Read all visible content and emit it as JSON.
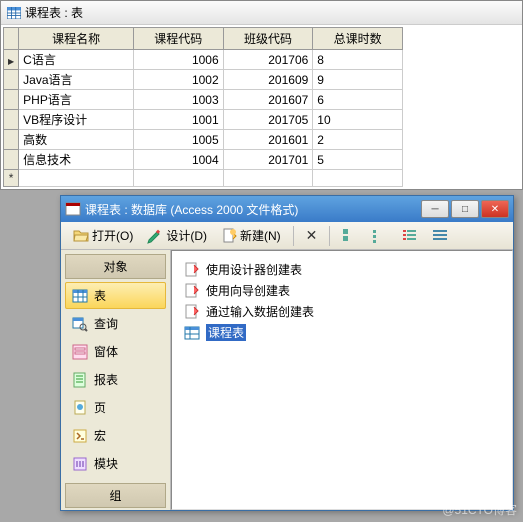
{
  "table_window": {
    "title": "课程表 : 表",
    "columns": [
      "课程名称",
      "课程代码",
      "班级代码",
      "总课时数"
    ],
    "rows": [
      {
        "c1": "C语言",
        "c2": "1006",
        "c3": "201706",
        "c4": "8"
      },
      {
        "c1": "Java语言",
        "c2": "1002",
        "c3": "201609",
        "c4": "9"
      },
      {
        "c1": "PHP语言",
        "c2": "1003",
        "c3": "201607",
        "c4": "6"
      },
      {
        "c1": "VB程序设计",
        "c2": "1001",
        "c3": "201705",
        "c4": "10"
      },
      {
        "c1": "高数",
        "c2": "1005",
        "c3": "201601",
        "c4": "2"
      },
      {
        "c1": "信息技术",
        "c2": "1004",
        "c3": "201701",
        "c4": "5"
      }
    ]
  },
  "db_window": {
    "title": "课程表 : 数据库 (Access 2000 文件格式)",
    "toolbar": {
      "open": "打开(O)",
      "design": "设计(D)",
      "new": "新建(N)"
    },
    "sidebar": {
      "header": "对象",
      "items": [
        {
          "label": "表"
        },
        {
          "label": "查询"
        },
        {
          "label": "窗体"
        },
        {
          "label": "报表"
        },
        {
          "label": "页"
        },
        {
          "label": "宏"
        },
        {
          "label": "模块"
        }
      ],
      "footer": "组"
    },
    "main": {
      "items": [
        {
          "label": "使用设计器创建表"
        },
        {
          "label": "使用向导创建表"
        },
        {
          "label": "通过输入数据创建表"
        },
        {
          "label": "课程表"
        }
      ]
    }
  },
  "watermark": "@51CTO博客"
}
